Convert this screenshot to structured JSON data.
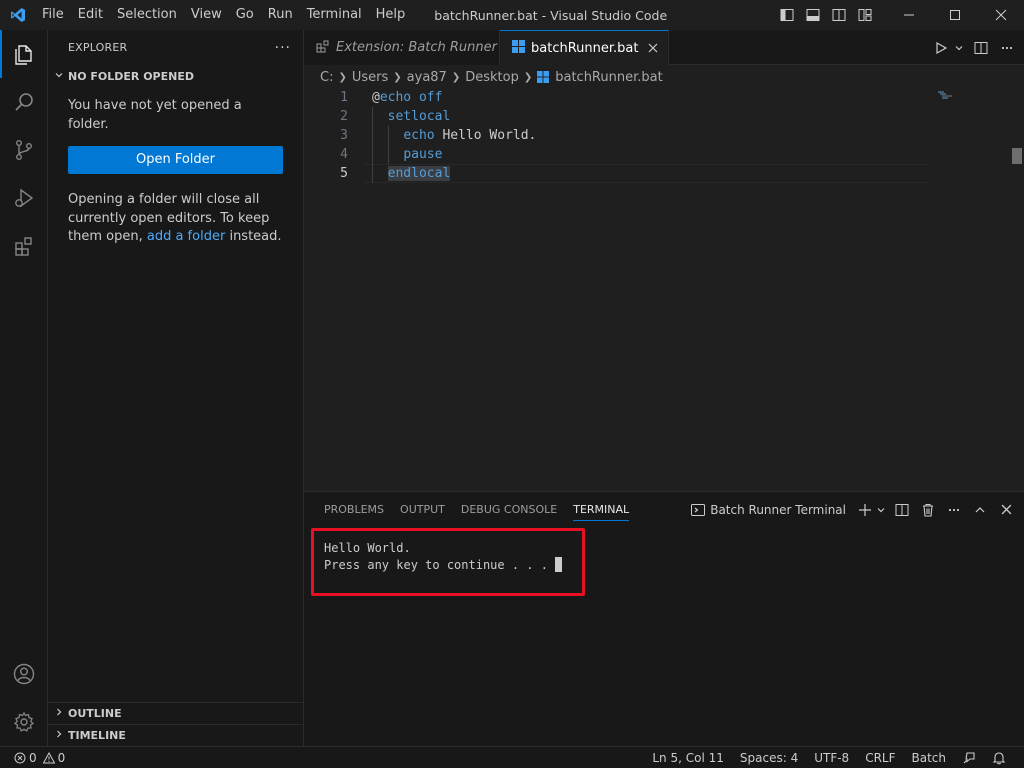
{
  "titlebar": {
    "menu": [
      "File",
      "Edit",
      "Selection",
      "View",
      "Go",
      "Run",
      "Terminal",
      "Help"
    ],
    "window_title": "batchRunner.bat - Visual Studio Code"
  },
  "sidebar": {
    "title": "EXPLORER",
    "more": "···",
    "section": "NO FOLDER OPENED",
    "message": "You have not yet opened a folder.",
    "open_button": "Open Folder",
    "info_prefix": "Opening a folder will close all currently open editors. To keep them open,",
    "info_link": "add a folder",
    "info_suffix": "instead.",
    "outline": "OUTLINE",
    "timeline": "TIMELINE"
  },
  "tabs": [
    {
      "label": "Extension: Batch Runner",
      "active": false
    },
    {
      "label": "batchRunner.bat",
      "active": true
    }
  ],
  "breadcrumb": [
    "C:",
    "Users",
    "aya87",
    "Desktop",
    "batchRunner.bat"
  ],
  "editor": {
    "lines": [
      {
        "num": "1",
        "indent": "",
        "parts": [
          [
            "at",
            "@"
          ],
          [
            "kw",
            "echo off"
          ]
        ]
      },
      {
        "num": "2",
        "indent": "  ",
        "parts": [
          [
            "kw",
            "setlocal"
          ]
        ]
      },
      {
        "num": "3",
        "indent": "    ",
        "parts": [
          [
            "kw",
            "echo"
          ],
          [
            "at",
            " Hello World."
          ]
        ]
      },
      {
        "num": "4",
        "indent": "    ",
        "parts": [
          [
            "kw",
            "pause"
          ]
        ]
      },
      {
        "num": "5",
        "indent": "  ",
        "parts": [
          [
            "kw hl",
            "endlocal"
          ]
        ]
      }
    ],
    "current_line": 5
  },
  "panel": {
    "tabs": [
      "PROBLEMS",
      "OUTPUT",
      "DEBUG CONSOLE",
      "TERMINAL"
    ],
    "active_tab": "TERMINAL",
    "terminal_name": "Batch Runner Terminal",
    "output": [
      "Hello World.",
      "Press any key to continue . . . "
    ]
  },
  "status": {
    "errors": "0",
    "warnings": "0",
    "position": "Ln 5, Col 11",
    "spaces": "Spaces: 4",
    "encoding": "UTF-8",
    "eol": "CRLF",
    "language": "Batch"
  },
  "colors": {
    "accent": "#0078d4",
    "keyword": "#569cd6",
    "highlight_box": "#e81123"
  }
}
